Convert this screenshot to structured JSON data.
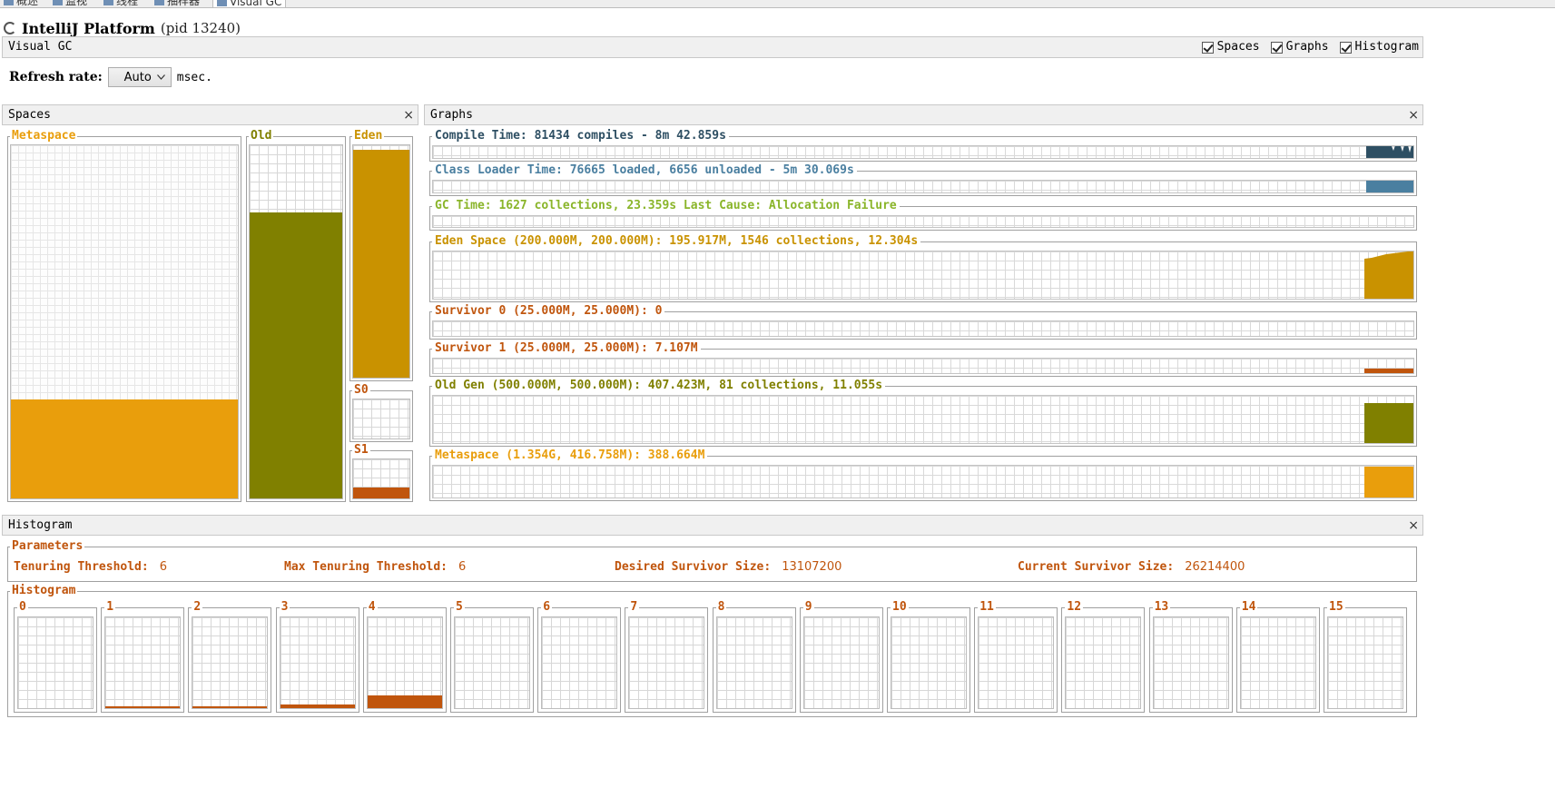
{
  "top_tabs": [
    "概述",
    "监视",
    "线程",
    "抽样器",
    "Visual GC"
  ],
  "app": {
    "name": "IntelliJ Platform",
    "pid": "(pid 13240)"
  },
  "visual_gc": {
    "title": "Visual GC",
    "options": [
      {
        "label": "Spaces",
        "checked": true
      },
      {
        "label": "Graphs",
        "checked": true
      },
      {
        "label": "Histogram",
        "checked": true
      }
    ]
  },
  "refresh": {
    "label": "Refresh rate:",
    "value": "Auto",
    "unit": "msec."
  },
  "spaces_panel": {
    "title": "Spaces",
    "close": "×",
    "metaspace": {
      "label": "Metaspace",
      "fill": 0.28,
      "color": "#e99e0c"
    },
    "old": {
      "label": "Old",
      "fill": 0.81,
      "color": "#808000"
    },
    "eden": {
      "label": "Eden",
      "fill": 0.98,
      "color": "#c99200"
    },
    "s0": {
      "label": "S0",
      "fill": 0.0,
      "color": "#c0550d"
    },
    "s1": {
      "label": "S1",
      "fill": 0.28,
      "color": "#c0550d"
    }
  },
  "graphs_panel": {
    "title": "Graphs",
    "close": "×",
    "rows": [
      {
        "label": "Compile Time: 81434 compiles - 8m 42.859s",
        "color": "#2e4f63"
      },
      {
        "label": "Class Loader Time: 76665 loaded, 6656 unloaded - 5m 30.069s",
        "color": "#4a7fa0"
      },
      {
        "label": "GC Time: 1627 collections, 23.359s  Last Cause: Allocation Failure",
        "color": "#8ab52a"
      },
      {
        "label": "Eden Space (200.000M, 200.000M): 195.917M, 1546 collections, 12.304s",
        "color": "#c99200"
      },
      {
        "label": "Survivor 0 (25.000M, 25.000M): 0",
        "color": "#c0550d"
      },
      {
        "label": "Survivor 1 (25.000M, 25.000M): 7.107M",
        "color": "#c0550d"
      },
      {
        "label": "Old Gen (500.000M, 500.000M): 407.423M, 81 collections, 11.055s",
        "color": "#808000"
      },
      {
        "label": "Metaspace (1.354G, 416.758M): 388.664M",
        "color": "#e99e0c"
      }
    ]
  },
  "histogram_panel": {
    "title": "Histogram",
    "close": "×",
    "parameters_title": "Parameters",
    "parameters": [
      {
        "label": "Tenuring Threshold:",
        "value": "6"
      },
      {
        "label": "Max Tenuring Threshold:",
        "value": "6"
      },
      {
        "label": "Desired Survivor Size:",
        "value": "13107200"
      },
      {
        "label": "Current Survivor Size:",
        "value": "26214400"
      }
    ],
    "histogram_title": "Histogram",
    "bins": [
      {
        "label": "0",
        "fill": 0.0
      },
      {
        "label": "1",
        "fill": 0.02
      },
      {
        "label": "2",
        "fill": 0.02
      },
      {
        "label": "3",
        "fill": 0.04
      },
      {
        "label": "4",
        "fill": 0.14
      },
      {
        "label": "5",
        "fill": 0.0
      },
      {
        "label": "6",
        "fill": 0.0
      },
      {
        "label": "7",
        "fill": 0.0
      },
      {
        "label": "8",
        "fill": 0.0
      },
      {
        "label": "9",
        "fill": 0.0
      },
      {
        "label": "10",
        "fill": 0.0
      },
      {
        "label": "11",
        "fill": 0.0
      },
      {
        "label": "12",
        "fill": 0.0
      },
      {
        "label": "13",
        "fill": 0.0
      },
      {
        "label": "14",
        "fill": 0.0
      },
      {
        "label": "15",
        "fill": 0.0
      }
    ],
    "bar_color": "#c0550d"
  }
}
